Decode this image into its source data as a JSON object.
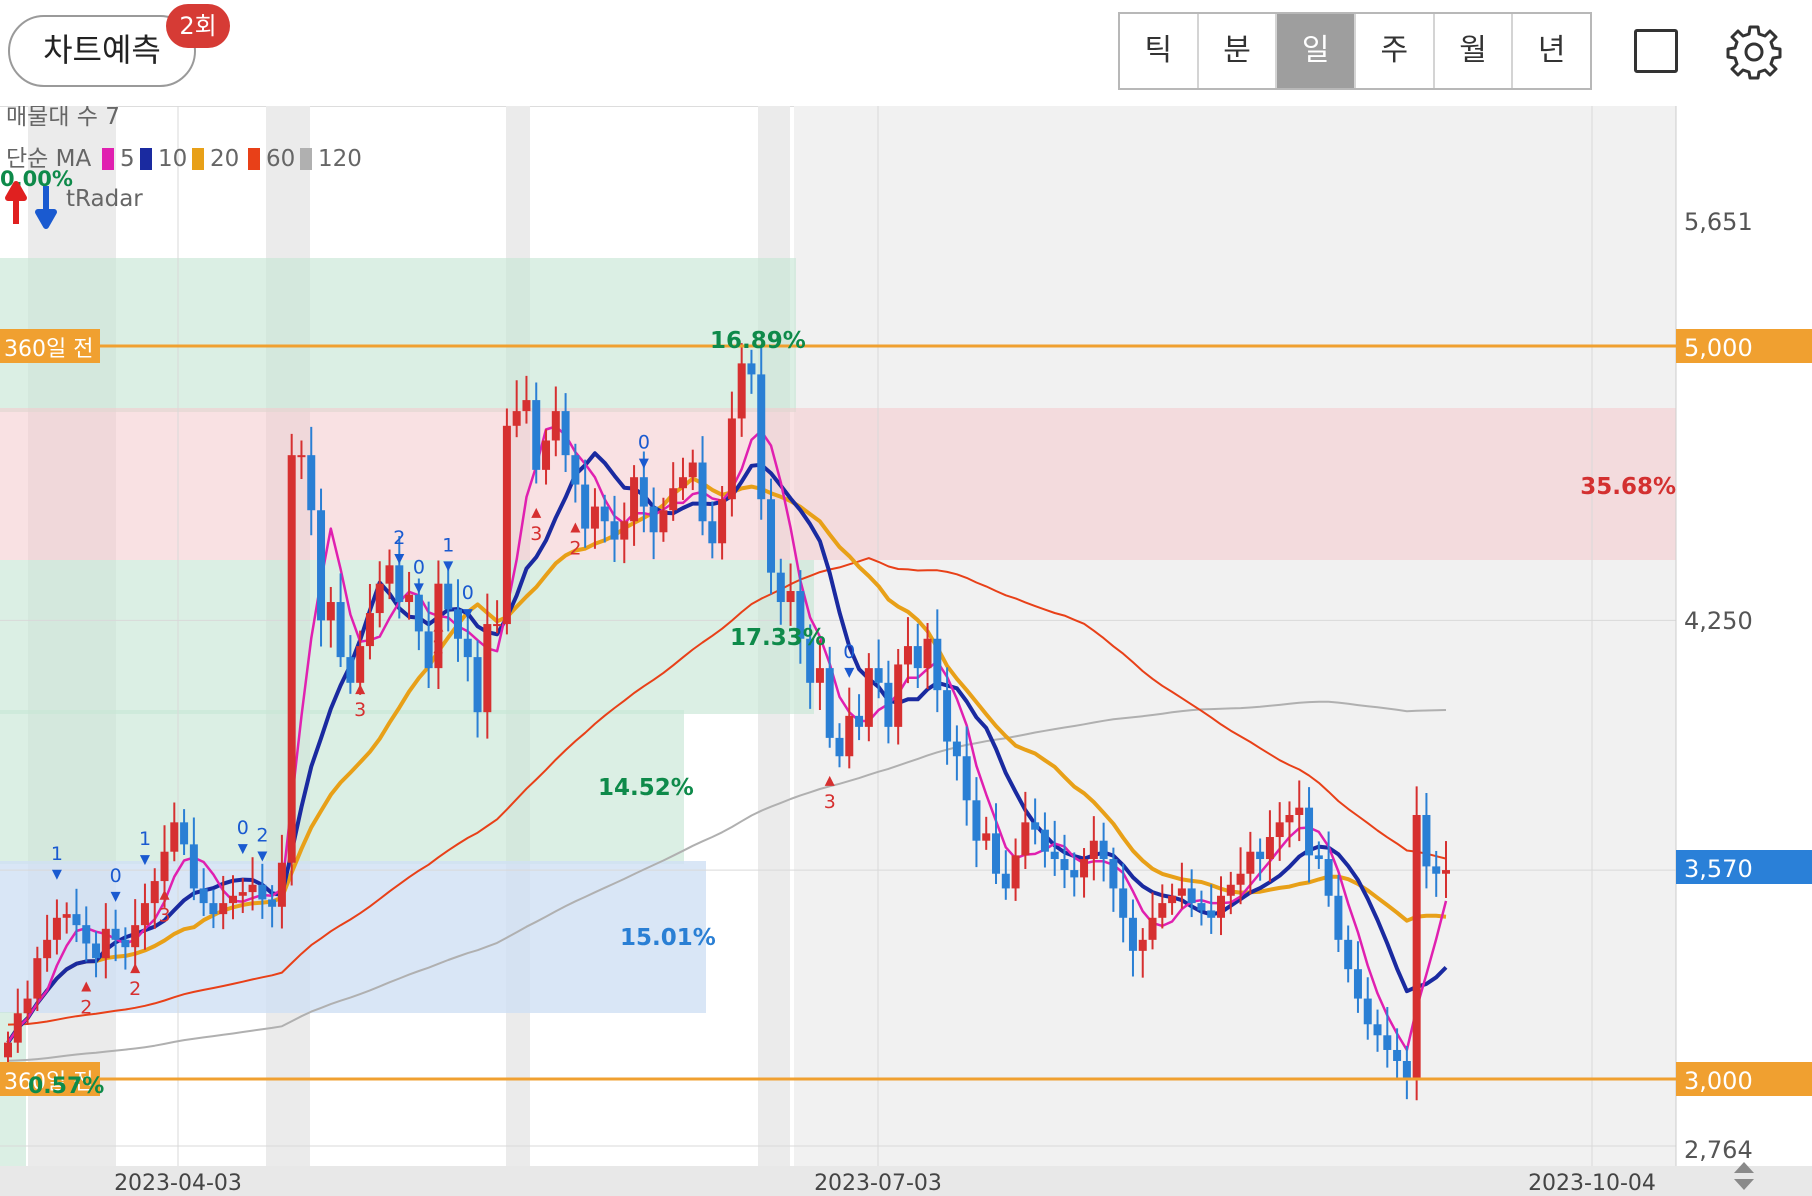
{
  "topbar": {
    "predict_label": "차트예측",
    "predict_badge": "2회",
    "periods": [
      "틱",
      "분",
      "일",
      "주",
      "월",
      "년"
    ],
    "active_period": "일"
  },
  "overlay": {
    "volume_profile": "매물대 수 7",
    "ma_title": "단순 MA",
    "ma_legend": [
      {
        "period": "5",
        "color": "#e020b0"
      },
      {
        "period": "10",
        "color": "#1a2aa0"
      },
      {
        "period": "20",
        "color": "#e8a018"
      },
      {
        "period": "60",
        "color": "#e84018"
      },
      {
        "period": "120",
        "color": "#b0b0b0"
      }
    ],
    "radar_pct": "0.00%",
    "radar_label": "tRadar"
  },
  "chart_data": {
    "type": "candlestick",
    "y_ticks": [
      "5,651",
      "5,000",
      "4,250",
      "3,570",
      "2,764"
    ],
    "y_range": [
      2764,
      5651
    ],
    "x_labels": [
      "2023-04-03",
      "2023-07-03",
      "2023-10-04"
    ],
    "hlines": [
      {
        "label": "360일 전",
        "value": 5000,
        "axis_label": "5,000"
      },
      {
        "label": "360일 전",
        "value": 3000,
        "axis_label": "3,000"
      }
    ],
    "current_price": "3,570",
    "zones": [
      {
        "pct": "16.89%",
        "color": "#0e8a4a"
      },
      {
        "pct": "35.68%",
        "color": "#d33030"
      },
      {
        "pct": "17.33%",
        "color": "#0e8a4a"
      },
      {
        "pct": "14.52%",
        "color": "#0e8a4a"
      },
      {
        "pct": "15.01%",
        "color": "#2a7fd4"
      },
      {
        "pct": "0.57%",
        "color": "#0e8a4a"
      }
    ],
    "colors": {
      "up": "#d63030",
      "down": "#2a7fd4"
    }
  }
}
